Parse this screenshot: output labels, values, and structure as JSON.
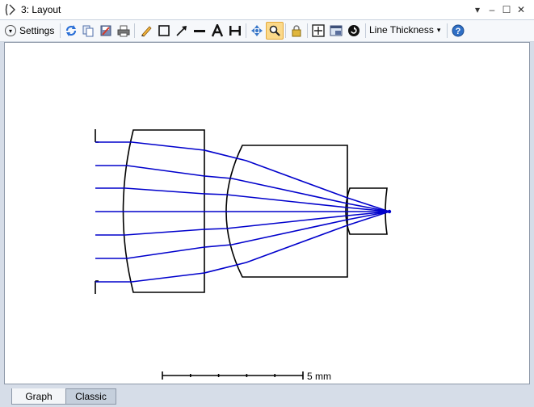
{
  "window": {
    "title": "3: Layout"
  },
  "toolbar": {
    "settings_label": "Settings",
    "line_thickness_label": "Line Thickness"
  },
  "icons": {
    "app": "layout-window-icon",
    "refresh": "refresh-icon",
    "copy": "copy-icon",
    "save": "save-icon",
    "print": "print-icon",
    "pencil": "pencil-icon",
    "rectangle": "rectangle-icon",
    "arrow": "arrow-icon",
    "line": "line-icon",
    "text": "text-icon",
    "dimension": "dimension-icon",
    "pan": "pan-icon",
    "zoom": "zoom-icon",
    "lock": "lock-icon",
    "fit": "fit-icon",
    "window": "window-icon",
    "rotate": "rotate-icon",
    "help": "help-icon"
  },
  "scale_bar": {
    "label": "5 mm"
  },
  "tabs": [
    {
      "label": "Graph",
      "selected": true
    },
    {
      "label": "Classic",
      "selected": false
    }
  ],
  "colors": {
    "rays": "#0000cc",
    "lens_outline": "#000000",
    "active_tool": "#fbd98a"
  }
}
